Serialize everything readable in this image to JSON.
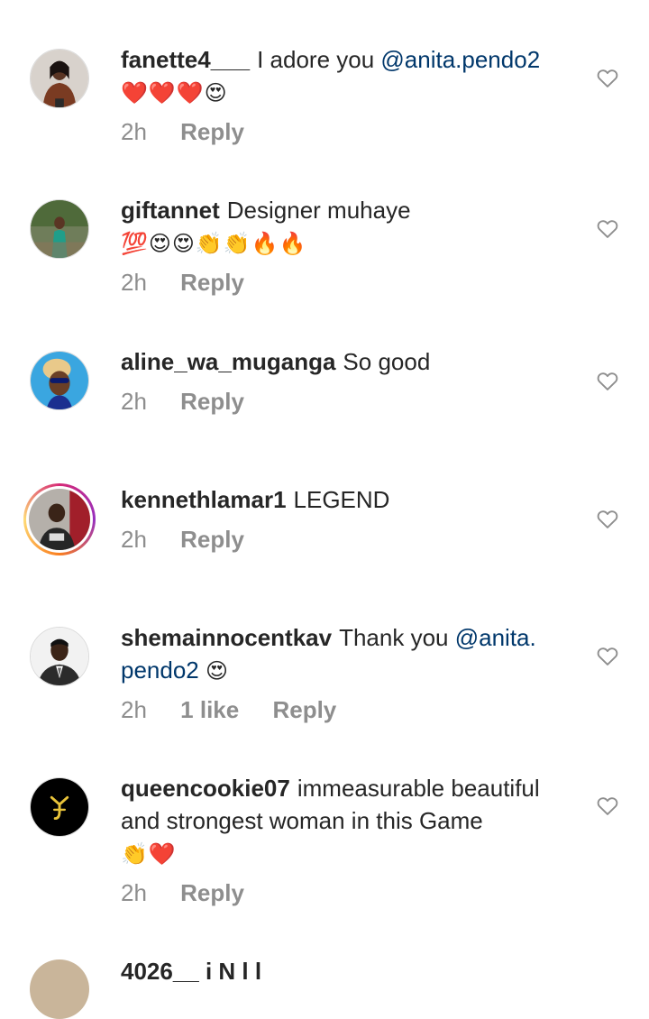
{
  "comments": [
    {
      "username": "fanette4___",
      "text": "I adore you ",
      "mention": "@anita.pendo2",
      "emoji_line": "❤️❤️❤️😍",
      "time": "2h",
      "reply_label": "Reply",
      "avatar_icon": "woman-brown-jacket-avatar"
    },
    {
      "username": "giftannet",
      "text": "Designer muhaye",
      "emoji_line": "💯😍😍👏👏🔥🔥",
      "time": "2h",
      "reply_label": "Reply",
      "avatar_icon": "woman-green-dress-avatar"
    },
    {
      "username": "aline_wa_muganga",
      "text": "So good",
      "time": "2h",
      "reply_label": "Reply",
      "avatar_icon": "woman-sunglasses-avatar"
    },
    {
      "username": "kennethlamar1",
      "text": "LEGEND",
      "time": "2h",
      "reply_label": "Reply",
      "avatar_icon": "man-with-story-ring-avatar"
    },
    {
      "username": "shemainnocentkav",
      "text": "Thank you ",
      "mention_part1": "@anita.",
      "mention_part2": "pendo2",
      "emoji_line": "😍",
      "time": "2h",
      "likes": "1 like",
      "reply_label": "Reply",
      "avatar_icon": "man-suit-avatar"
    },
    {
      "username": "queencookie07",
      "text": "immeasurable beautiful and strongest woman in this Game",
      "emoji_line": "👏❤️",
      "time": "2h",
      "reply_label": "Reply",
      "avatar_icon": "gold-logo-avatar"
    }
  ],
  "partial": {
    "text": "4026__ i  N  l  l"
  },
  "colors": {
    "mention": "#00376b",
    "meta": "#8e8e8e",
    "text": "#262626"
  }
}
